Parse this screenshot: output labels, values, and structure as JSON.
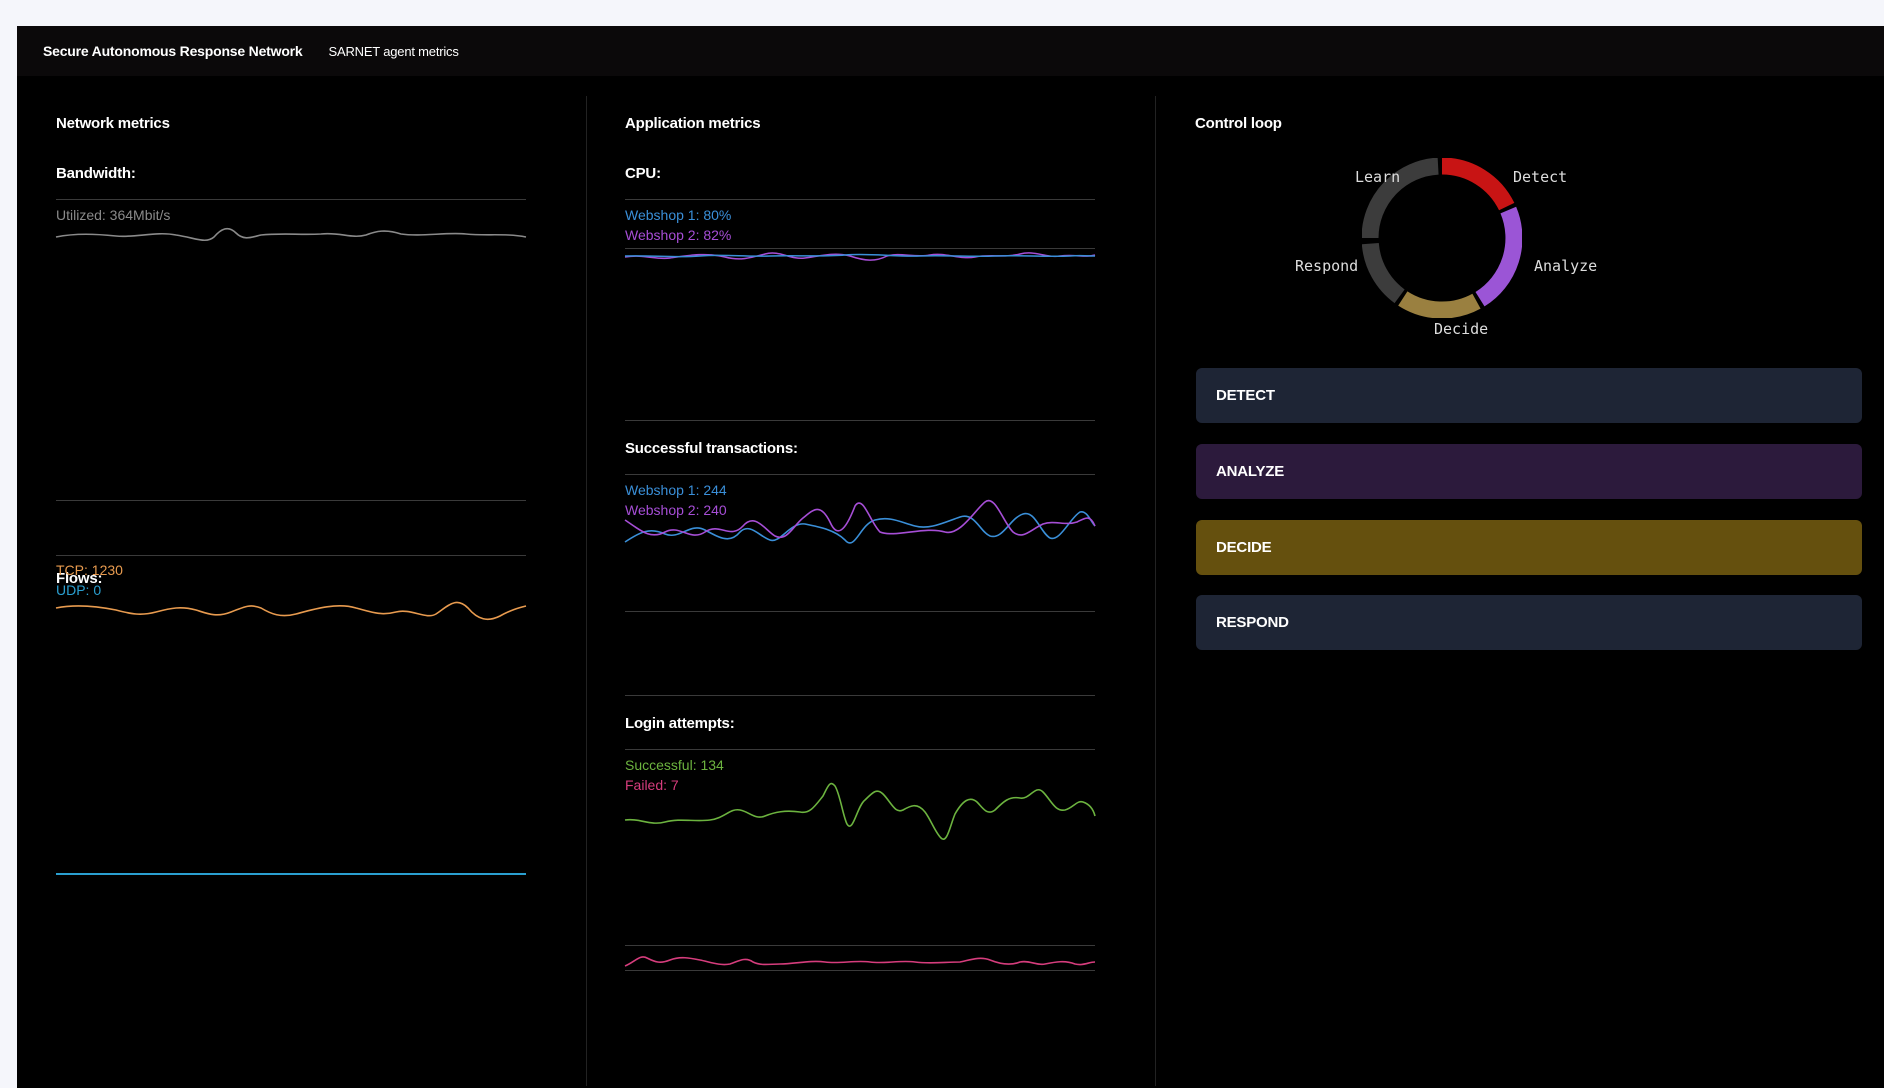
{
  "header": {
    "app_title": "Secure Autonomous Response Network",
    "subtitle": "SARNET agent metrics"
  },
  "network": {
    "title": "Network metrics",
    "bandwidth": {
      "label": "Bandwidth:",
      "utilized_text": "Utilized: 364Mbit/s",
      "color": "#8a8a8a"
    },
    "flows": {
      "label": "Flows:",
      "tcp_text": "TCP: 1230",
      "udp_text": "UDP: 0",
      "tcp_color": "#e89b4f",
      "udp_color": "#2a9fd0"
    }
  },
  "application": {
    "title": "Application metrics",
    "cpu": {
      "label": "CPU:",
      "webshop1_text": "Webshop 1: 80%",
      "webshop2_text": "Webshop 2: 82%",
      "webshop1_color": "#3a8fd8",
      "webshop2_color": "#a64ed6"
    },
    "transactions": {
      "label": "Successful transactions:",
      "webshop1_text": "Webshop 1: 244",
      "webshop2_text": "Webshop 2: 240"
    },
    "logins": {
      "label": "Login attempts:",
      "successful_text": "Successful: 134",
      "failed_text": "Failed: 7",
      "successful_color": "#6cb33f",
      "failed_color": "#d63d7d"
    }
  },
  "control_loop": {
    "title": "Control loop",
    "phases": [
      {
        "label": "Detect",
        "color": "#c81414"
      },
      {
        "label": "Analyze",
        "color": "#9b55d6"
      },
      {
        "label": "Decide",
        "color": "#9a8040"
      },
      {
        "label": "Respond",
        "color": "#3c3c3c"
      },
      {
        "label": "Learn",
        "color": "#3c3c3c"
      }
    ],
    "steps": [
      {
        "label": "DETECT",
        "color": "#1e2535"
      },
      {
        "label": "ANALYZE",
        "color": "#2c1a3c"
      },
      {
        "label": "DECIDE",
        "color": "#65500e"
      },
      {
        "label": "RESPOND",
        "color": "#1e2535"
      }
    ]
  }
}
